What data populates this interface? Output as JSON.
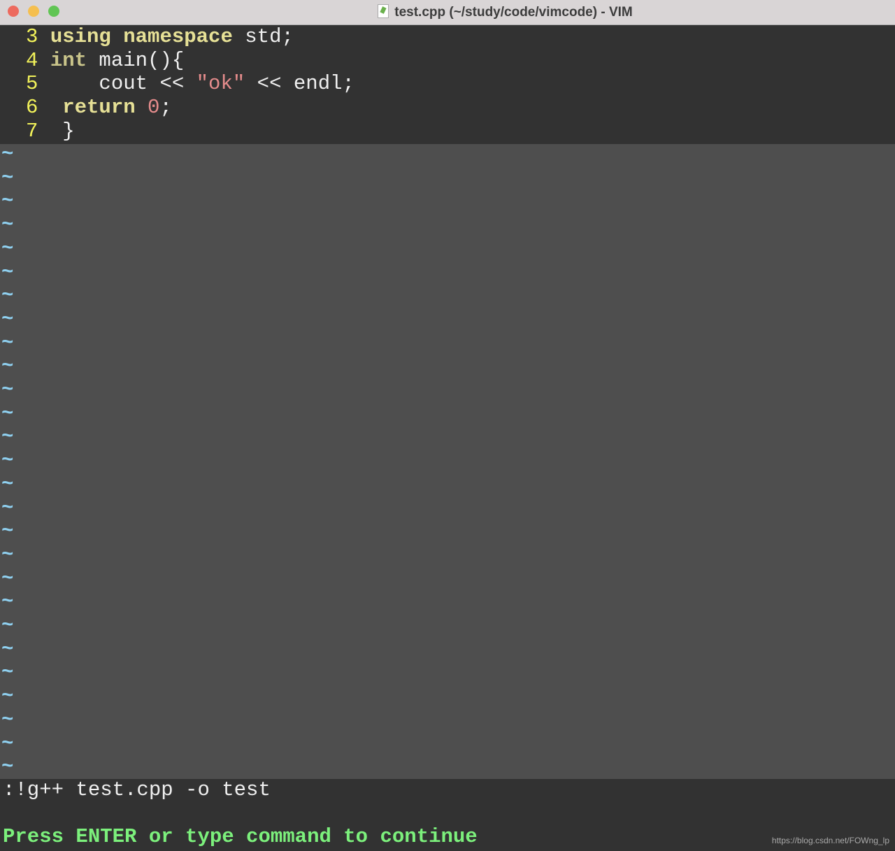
{
  "window": {
    "title": "test.cpp (~/study/code/vimcode) - VIM",
    "icon": "cpp-file-icon"
  },
  "code_lines": [
    {
      "num": "3",
      "parts": [
        {
          "t": "using",
          "c": "kw"
        },
        {
          "t": " "
        },
        {
          "t": "namespace",
          "c": "kw"
        },
        {
          "t": " std;"
        }
      ]
    },
    {
      "num": "4",
      "parts": [
        {
          "t": "int",
          "c": "ty"
        },
        {
          "t": " main(){"
        }
      ]
    },
    {
      "num": "5",
      "parts": [
        {
          "t": "    cout << "
        },
        {
          "t": "\"ok\"",
          "c": "str"
        },
        {
          "t": " << endl;"
        }
      ]
    },
    {
      "num": "6",
      "parts": [
        {
          "t": " "
        },
        {
          "t": "return",
          "c": "kw"
        },
        {
          "t": " "
        },
        {
          "t": "0",
          "c": "str"
        },
        {
          "t": ";"
        }
      ]
    },
    {
      "num": "7",
      "parts": [
        {
          "t": " }"
        }
      ]
    }
  ],
  "tilde_count": 27,
  "tilde": "~",
  "command_line": ":!g++ test.cpp -o test",
  "prompt": "Press ENTER or type command to continue",
  "watermark": "https://blog.csdn.net/FOWng_lp",
  "colors": {
    "line_number": "#f2f25a",
    "keyword": "#e6e096",
    "string": "#e58c8c",
    "tilde": "#8fd0f0",
    "prompt": "#7cf07c"
  }
}
